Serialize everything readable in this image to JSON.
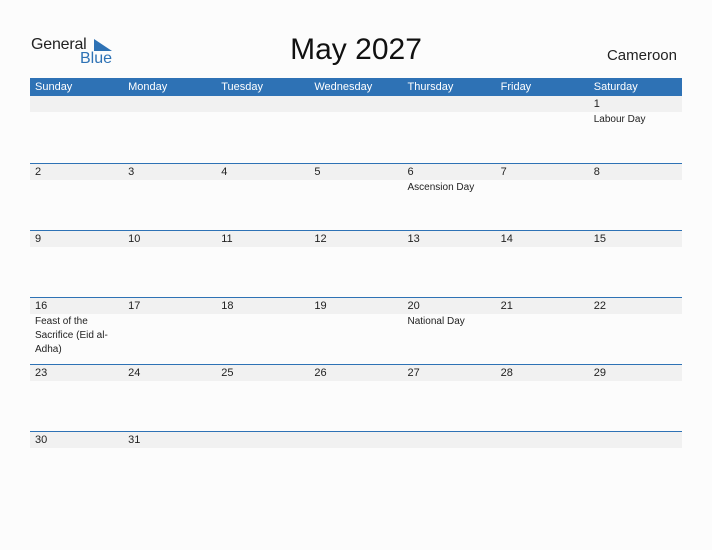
{
  "logo": {
    "general": "General",
    "blue": "Blue"
  },
  "header": {
    "title": "May 2027",
    "country": "Cameroon"
  },
  "colors": {
    "accent": "#2e72b5",
    "band": "#f1f1f1"
  },
  "weekdays": [
    "Sunday",
    "Monday",
    "Tuesday",
    "Wednesday",
    "Thursday",
    "Friday",
    "Saturday"
  ],
  "weeks": [
    {
      "days": [
        {
          "n": "",
          "h": ""
        },
        {
          "n": "",
          "h": ""
        },
        {
          "n": "",
          "h": ""
        },
        {
          "n": "",
          "h": ""
        },
        {
          "n": "",
          "h": ""
        },
        {
          "n": "",
          "h": ""
        },
        {
          "n": "1",
          "h": "Labour Day"
        }
      ]
    },
    {
      "days": [
        {
          "n": "2",
          "h": ""
        },
        {
          "n": "3",
          "h": ""
        },
        {
          "n": "4",
          "h": ""
        },
        {
          "n": "5",
          "h": ""
        },
        {
          "n": "6",
          "h": "Ascension Day"
        },
        {
          "n": "7",
          "h": ""
        },
        {
          "n": "8",
          "h": ""
        }
      ]
    },
    {
      "days": [
        {
          "n": "9",
          "h": ""
        },
        {
          "n": "10",
          "h": ""
        },
        {
          "n": "11",
          "h": ""
        },
        {
          "n": "12",
          "h": ""
        },
        {
          "n": "13",
          "h": ""
        },
        {
          "n": "14",
          "h": ""
        },
        {
          "n": "15",
          "h": ""
        }
      ]
    },
    {
      "days": [
        {
          "n": "16",
          "h": "Feast of the Sacrifice (Eid al-Adha)"
        },
        {
          "n": "17",
          "h": ""
        },
        {
          "n": "18",
          "h": ""
        },
        {
          "n": "19",
          "h": ""
        },
        {
          "n": "20",
          "h": "National Day"
        },
        {
          "n": "21",
          "h": ""
        },
        {
          "n": "22",
          "h": ""
        }
      ]
    },
    {
      "days": [
        {
          "n": "23",
          "h": ""
        },
        {
          "n": "24",
          "h": ""
        },
        {
          "n": "25",
          "h": ""
        },
        {
          "n": "26",
          "h": ""
        },
        {
          "n": "27",
          "h": ""
        },
        {
          "n": "28",
          "h": ""
        },
        {
          "n": "29",
          "h": ""
        }
      ]
    },
    {
      "days": [
        {
          "n": "30",
          "h": ""
        },
        {
          "n": "31",
          "h": ""
        },
        {
          "n": "",
          "h": ""
        },
        {
          "n": "",
          "h": ""
        },
        {
          "n": "",
          "h": ""
        },
        {
          "n": "",
          "h": ""
        },
        {
          "n": "",
          "h": ""
        }
      ]
    }
  ]
}
